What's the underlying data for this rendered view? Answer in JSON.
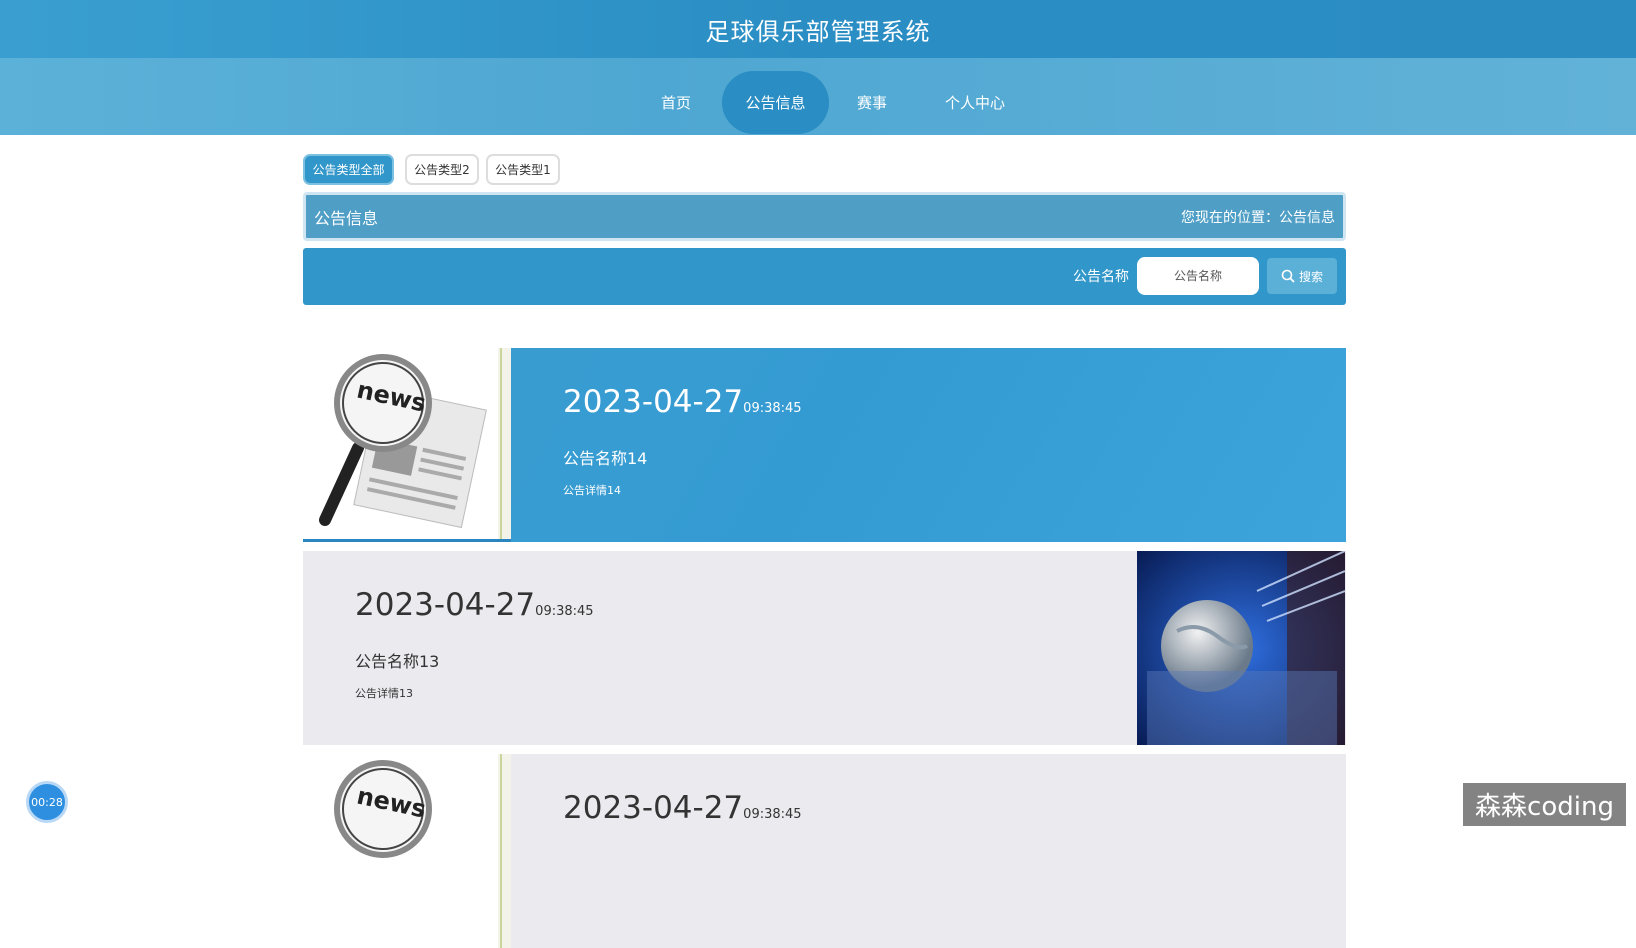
{
  "header": {
    "title": "足球俱乐部管理系统"
  },
  "nav": {
    "items": [
      "首页",
      "公告信息",
      "赛事",
      "个人中心"
    ],
    "active": "公告信息"
  },
  "filters": [
    "公告类型全部",
    "公告类型2",
    "公告类型1"
  ],
  "title_bar": {
    "title": "公告信息",
    "location": "您现在的位置：公告信息"
  },
  "search": {
    "label": "公告名称",
    "placeholder": "公告名称",
    "button": "搜索"
  },
  "notices": [
    {
      "date": "2023-04-27",
      "time": "09:38:45",
      "name": "公告名称14",
      "detail": "公告详情14",
      "image": "news-magnifier"
    },
    {
      "date": "2023-04-27",
      "time": "09:38:45",
      "name": "公告名称13",
      "detail": "公告详情13",
      "image": "news-broadcast-globe"
    },
    {
      "date": "2023-04-27",
      "time": "09:38:45",
      "name": "",
      "detail": "",
      "image": "news-magnifier"
    }
  ],
  "overlay": {
    "timer": "00:28",
    "watermark": "森森coding"
  },
  "colors": {
    "header": "#2a8ec4",
    "nav": "#4ea7d2",
    "accent": "#3196c9",
    "card_grey": "#ebeaef"
  }
}
